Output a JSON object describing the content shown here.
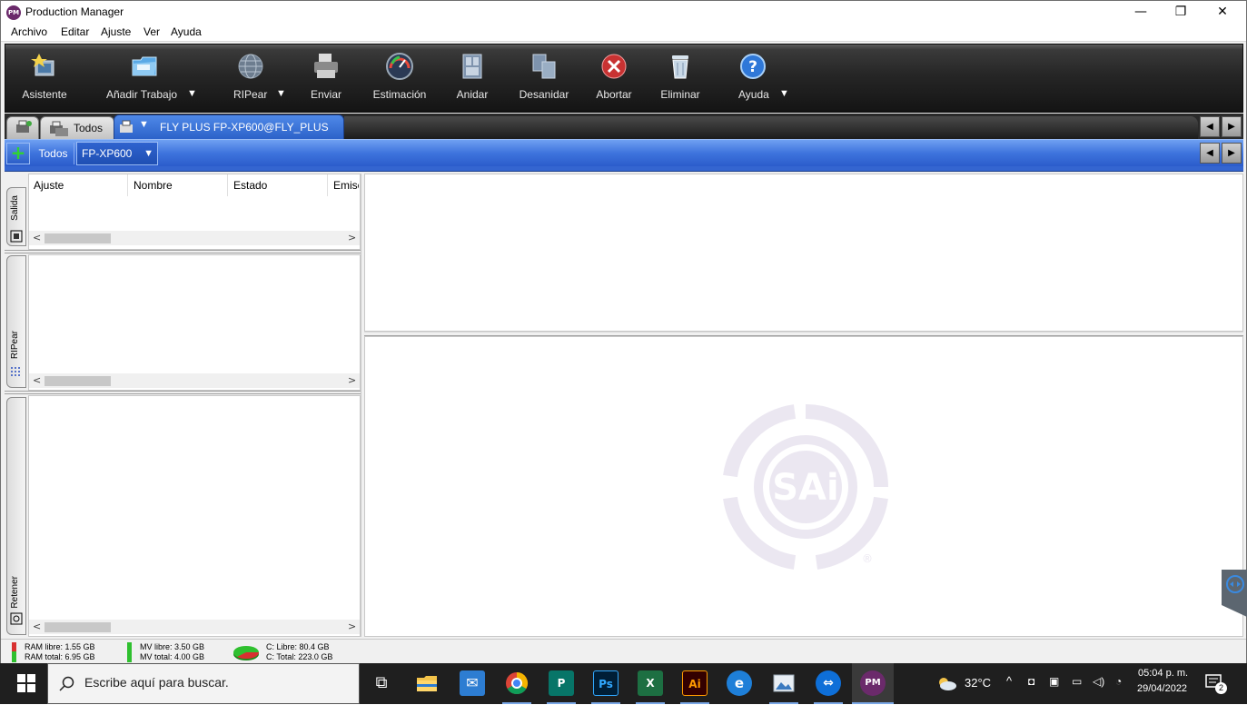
{
  "window": {
    "title": "Production Manager",
    "app_icon_text": "PM",
    "controls": {
      "minimize": "—",
      "restore": "❐",
      "close": "✕"
    }
  },
  "menubar": {
    "items": [
      "Archivo",
      "Editar",
      "Ajuste",
      "Ver",
      "Ayuda"
    ]
  },
  "toolbar": {
    "buttons": [
      {
        "label": "Asistente",
        "icon": "wizard-icon",
        "dropdown": false
      },
      {
        "label": "Añadir Trabajo",
        "icon": "folder-add-icon",
        "dropdown": true
      },
      {
        "label": "RIPear",
        "icon": "globe-icon",
        "dropdown": true
      },
      {
        "label": "Enviar",
        "icon": "printer-icon",
        "dropdown": false
      },
      {
        "label": "Estimación",
        "icon": "gauge-icon",
        "dropdown": false
      },
      {
        "label": "Anidar",
        "icon": "nest-icon",
        "dropdown": false
      },
      {
        "label": "Desanidar",
        "icon": "unnest-icon",
        "dropdown": false
      },
      {
        "label": "Abortar",
        "icon": "abort-icon",
        "dropdown": false
      },
      {
        "label": "Eliminar",
        "icon": "trash-icon",
        "dropdown": false
      },
      {
        "label": "Ayuda",
        "icon": "help-icon",
        "dropdown": true
      }
    ],
    "dropdown_glyph": "▼"
  },
  "tabs": {
    "todos_label": "Todos",
    "active_label": "FLY PLUS FP-XP600@FLY_PLUS",
    "nav_left": "◀",
    "nav_right": "▶"
  },
  "filterbar": {
    "add_glyph": "+",
    "todos_label": "Todos",
    "selected_filter": "FP-XP600"
  },
  "panes": {
    "salida": {
      "tab_label": "Salida",
      "columns": [
        "Ajuste",
        "Nombre",
        "Estado",
        "Emisc"
      ]
    },
    "ripear": {
      "tab_label": "RIPear"
    },
    "retener": {
      "tab_label": "Retener"
    },
    "scroll_left": "<",
    "scroll_right": ">"
  },
  "statusbar": {
    "ram_libre": "RAM libre: 1.55 GB",
    "ram_total": "RAM total: 6.95 GB",
    "mv_libre": "MV libre: 3.50 GB",
    "mv_total": "MV total: 4.00 GB",
    "c_libre": "C: Libre: 80.4 GB",
    "c_total": "C: Total: 223.0 GB",
    "colors": {
      "ram": "#d83030",
      "mv": "#2fc02f",
      "disk_used": "#d83030",
      "disk_free": "#2fc02f"
    }
  },
  "watermark": {
    "text": "SAi",
    "registered": "®"
  },
  "taskbar": {
    "search_placeholder": "Escribe aquí para buscar.",
    "apps": [
      {
        "name": "task-view-icon",
        "label": "⧉"
      },
      {
        "name": "file-explorer-icon",
        "label": ""
      },
      {
        "name": "mail-icon",
        "label": "✉"
      },
      {
        "name": "chrome-icon",
        "label": ""
      },
      {
        "name": "publisher-icon",
        "label": "P"
      },
      {
        "name": "photoshop-icon",
        "label": "Ps"
      },
      {
        "name": "excel-icon",
        "label": "X"
      },
      {
        "name": "illustrator-icon",
        "label": "Ai"
      },
      {
        "name": "edge-icon",
        "label": "e"
      },
      {
        "name": "photos-icon",
        "label": ""
      },
      {
        "name": "teamviewer-icon",
        "label": "⇔"
      },
      {
        "name": "production-manager-icon",
        "label": "PM"
      }
    ],
    "weather": "32°C",
    "time": "05:04 p. m.",
    "date": "29/04/2022",
    "notification_count": "2"
  }
}
